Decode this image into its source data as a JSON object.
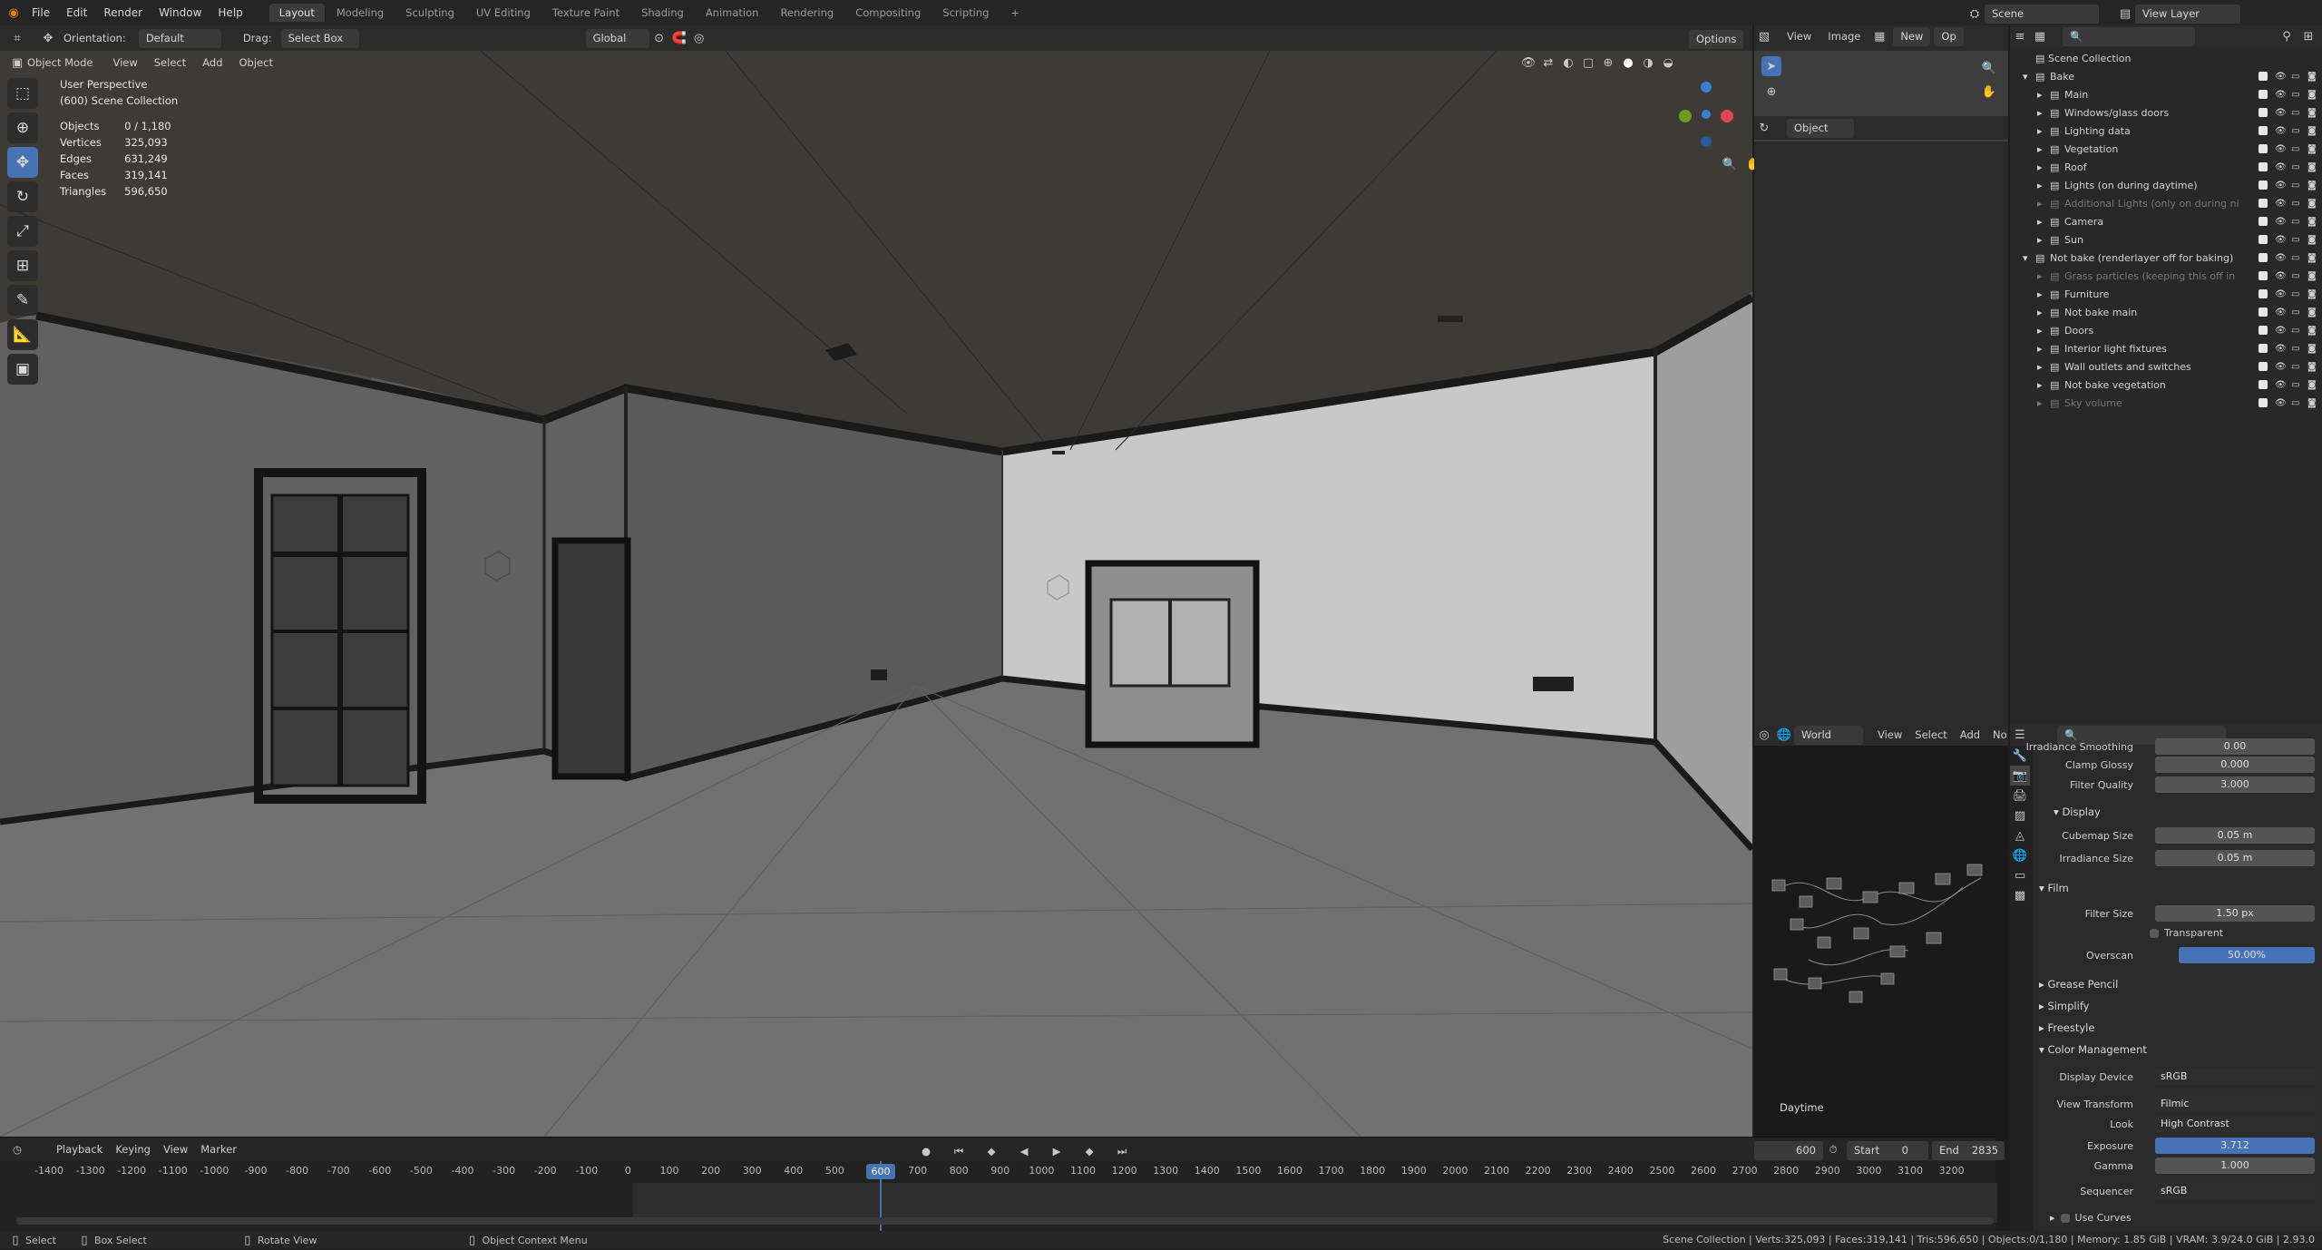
{
  "menu": {
    "items": [
      "File",
      "Edit",
      "Render",
      "Window",
      "Help"
    ]
  },
  "workspaces": [
    "Layout",
    "Modeling",
    "Sculpting",
    "UV Editing",
    "Texture Paint",
    "Shading",
    "Animation",
    "Rendering",
    "Compositing",
    "Scripting"
  ],
  "active_workspace": "Layout",
  "scene": {
    "name": "Scene",
    "view_layer": "View Layer"
  },
  "viewport_header": {
    "orientation_label": "Orientation:",
    "orientation_value": "Default",
    "drag_label": "Drag:",
    "drag_value": "Select Box",
    "transform": "Global",
    "options": "Options",
    "mode": "Object Mode",
    "menus": [
      "View",
      "Select",
      "Add",
      "Object"
    ]
  },
  "overlay_text": {
    "perspective": "User Perspective",
    "collection": "(600) Scene Collection",
    "stats": [
      {
        "k": "Objects",
        "v": "0 / 1,180"
      },
      {
        "k": "Vertices",
        "v": "325,093"
      },
      {
        "k": "Edges",
        "v": "631,249"
      },
      {
        "k": "Faces",
        "v": "319,141"
      },
      {
        "k": "Triangles",
        "v": "596,650"
      }
    ]
  },
  "image_editor": {
    "menus": [
      "View",
      "Image"
    ],
    "new_label": "New",
    "open_label": "Op",
    "object_label": "Object"
  },
  "outliner": {
    "title": "Scene Collection",
    "items": [
      {
        "name": "Bake",
        "depth": 1,
        "dim": false
      },
      {
        "name": "Main",
        "depth": 2,
        "dim": false
      },
      {
        "name": "Windows/glass doors",
        "depth": 2,
        "dim": false
      },
      {
        "name": "Lighting data",
        "depth": 2,
        "dim": false
      },
      {
        "name": "Vegetation",
        "depth": 2,
        "dim": false
      },
      {
        "name": "Roof",
        "depth": 2,
        "dim": false
      },
      {
        "name": "Lights (on during daytime)",
        "depth": 2,
        "dim": false
      },
      {
        "name": "Additional Lights (only on during ni",
        "depth": 2,
        "dim": true
      },
      {
        "name": "Camera",
        "depth": 2,
        "dim": false
      },
      {
        "name": "Sun",
        "depth": 2,
        "dim": false
      },
      {
        "name": "Not bake (renderlayer off for baking)",
        "depth": 1,
        "dim": false
      },
      {
        "name": "Grass particles (keeping this off in",
        "depth": 2,
        "dim": true
      },
      {
        "name": "Furniture",
        "depth": 2,
        "dim": false
      },
      {
        "name": "Not bake main",
        "depth": 2,
        "dim": false
      },
      {
        "name": "Doors",
        "depth": 2,
        "dim": false
      },
      {
        "name": "Interior light fixtures",
        "depth": 2,
        "dim": false
      },
      {
        "name": "Wall outlets and switches",
        "depth": 2,
        "dim": false
      },
      {
        "name": "Not bake vegetation",
        "depth": 2,
        "dim": false
      },
      {
        "name": "Sky volume",
        "depth": 2,
        "dim": true
      }
    ]
  },
  "node_editor": {
    "world_label": "World",
    "menus": [
      "View",
      "Select",
      "Add",
      "No"
    ],
    "world_name": "Daytime"
  },
  "properties": {
    "rows": [
      {
        "label": "Irradiance Smoothing",
        "value": "0.00"
      },
      {
        "label": "Clamp Glossy",
        "value": "0.000"
      },
      {
        "label": "Filter Quality",
        "value": "3.000"
      }
    ],
    "display_section": "Display",
    "display_rows": [
      {
        "label": "Cubemap Size",
        "value": "0.05 m"
      },
      {
        "label": "Irradiance Size",
        "value": "0.05 m"
      }
    ],
    "film_section": "Film",
    "film_rows": [
      {
        "label": "Filter Size",
        "value": "1.50 px"
      }
    ],
    "transparent_label": "Transparent",
    "overscan_label": "Overscan",
    "overscan_value": "50.00%",
    "collapsed": [
      "Grease Pencil",
      "Simplify",
      "Freestyle"
    ],
    "color_mgmt_section": "Color Management",
    "cm_rows": [
      {
        "label": "Display Device",
        "value": "sRGB"
      },
      {
        "label": "View Transform",
        "value": "Filmic"
      },
      {
        "label": "Look",
        "value": "High Contrast"
      }
    ],
    "exposure_label": "Exposure",
    "exposure_value": "3.712",
    "gamma_label": "Gamma",
    "gamma_value": "1.000",
    "sequencer_label": "Sequencer",
    "sequencer_value": "sRGB",
    "use_curves": "Use Curves"
  },
  "timeline": {
    "menus": [
      "Playback",
      "Keying",
      "View",
      "Marker"
    ],
    "current_frame": "600",
    "start_label": "Start",
    "start_value": "0",
    "end_label": "End",
    "end_value": "2835",
    "ticks": [
      "-1400",
      "-1300",
      "-1200",
      "-1100",
      "-1000",
      "-900",
      "-800",
      "-700",
      "-600",
      "-500",
      "-400",
      "-300",
      "-200",
      "-100",
      "0",
      "100",
      "200",
      "300",
      "400",
      "500",
      "600",
      "700",
      "800",
      "900",
      "1000",
      "1100",
      "1200",
      "1300",
      "1400",
      "1500",
      "1600",
      "1700",
      "1800",
      "1900",
      "2000",
      "2100",
      "2200",
      "2300",
      "2400",
      "2500",
      "2600",
      "2700",
      "2800",
      "2900",
      "3000",
      "3100",
      "3200"
    ]
  },
  "status": {
    "left": [
      "Select",
      "Box Select",
      "Rotate View",
      "Object Context Menu"
    ],
    "right": "Scene Collection | Verts:325,093 | Faces:319,141 | Tris:596,650 | Objects:0/1,180 | Memory: 1.85 GiB | VRAM: 3.9/24.0 GiB | 2.93.0"
  },
  "colors": {
    "accent": "#4772b3",
    "bg": "#1d1d1d",
    "viewport": "#595959"
  }
}
